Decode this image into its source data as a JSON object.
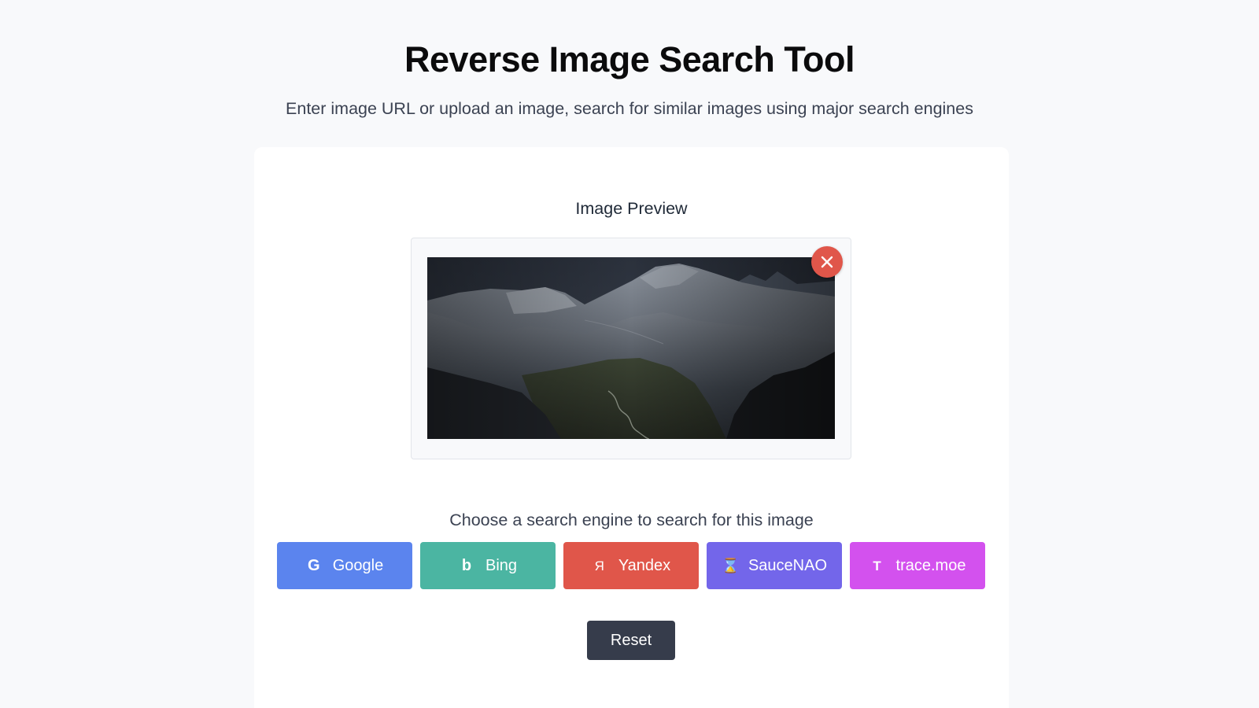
{
  "header": {
    "title": "Reverse Image Search Tool",
    "subtitle": "Enter image URL or upload an image, search for similar images using major search engines"
  },
  "preview": {
    "heading": "Image Preview",
    "image_alt": "Mountain landscape",
    "remove_icon": "close-icon"
  },
  "engines": {
    "prompt": "Choose a search engine to search for this image",
    "buttons": [
      {
        "label": "Google",
        "icon": "G",
        "color": "#5b84ee"
      },
      {
        "label": "Bing",
        "icon": "b",
        "color": "#4bb5a2"
      },
      {
        "label": "Yandex",
        "icon": "Я",
        "color": "#e0564a"
      },
      {
        "label": "SauceNAO",
        "icon": "⌛",
        "color": "#7366ea"
      },
      {
        "label": "trace.moe",
        "icon": "T",
        "color": "#d351ee"
      }
    ]
  },
  "actions": {
    "reset_label": "Reset"
  }
}
